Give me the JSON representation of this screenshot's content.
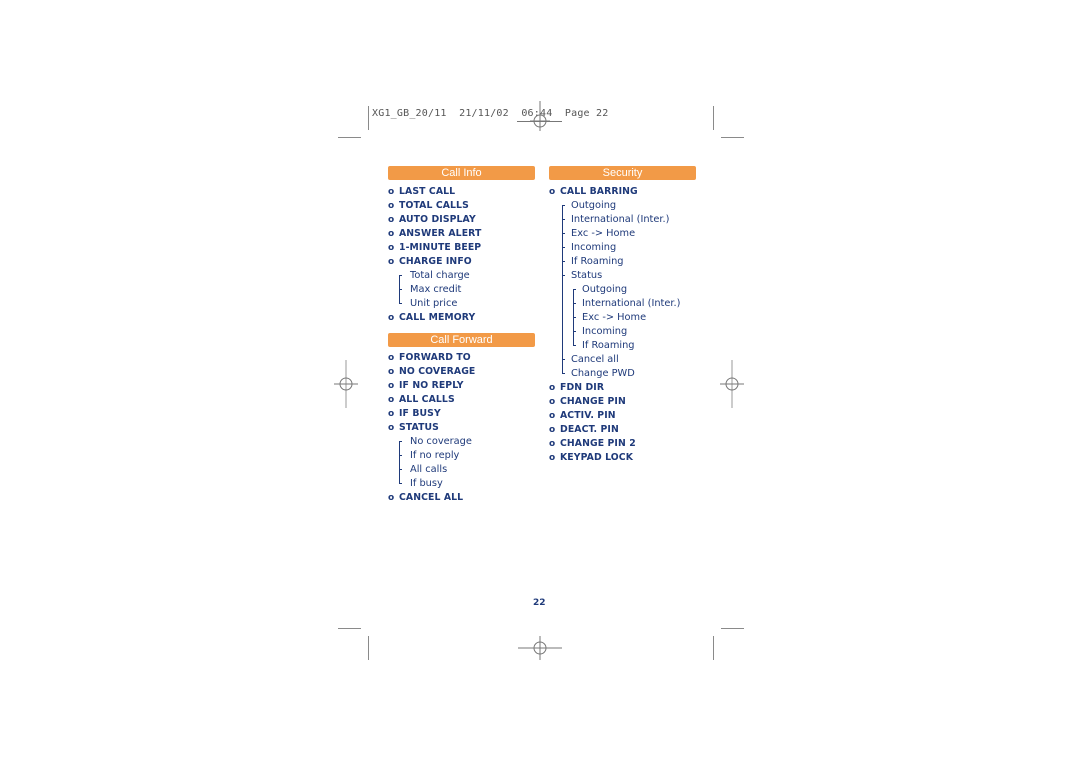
{
  "header": {
    "file": "XG1_GB_20/11",
    "date": "21/11/02",
    "time": "06:44",
    "page_label": "Page",
    "page_number": "22"
  },
  "columns": {
    "left": {
      "sections": [
        {
          "title": "Call Info",
          "items": [
            {
              "label": "LAST CALL"
            },
            {
              "label": "TOTAL CALLS"
            },
            {
              "label": "AUTO DISPLAY"
            },
            {
              "label": "ANSWER ALERT"
            },
            {
              "label": "1-MINUTE BEEP"
            },
            {
              "label": "CHARGE INFO",
              "children": [
                "Total charge",
                "Max credit",
                "Unit price"
              ]
            },
            {
              "label": "CALL MEMORY"
            }
          ]
        },
        {
          "title": "Call Forward",
          "items": [
            {
              "label": "FORWARD TO"
            },
            {
              "label": "NO COVERAGE"
            },
            {
              "label": "IF NO REPLY"
            },
            {
              "label": "ALL CALLS"
            },
            {
              "label": "IF BUSY"
            },
            {
              "label": "STATUS",
              "children": [
                "No coverage",
                "If no reply",
                "All calls",
                "If busy"
              ]
            },
            {
              "label": "CANCEL ALL"
            }
          ]
        }
      ]
    },
    "right": {
      "sections": [
        {
          "title": "Security",
          "items": [
            {
              "label": "CALL BARRING",
              "children": [
                "Outgoing",
                "International (Inter.)",
                "Exc -> Home",
                "Incoming",
                "If Roaming",
                "Status",
                "Outgoing",
                "International (Inter.)",
                "Exc -> Home",
                "Incoming",
                "If Roaming",
                "Cancel all",
                "Change PWD"
              ]
            },
            {
              "label": "FDN DIR"
            },
            {
              "label": "CHANGE PIN"
            },
            {
              "label": "ACTIV. PIN"
            },
            {
              "label": "DEACT. PIN"
            },
            {
              "label": "CHANGE PIN 2"
            },
            {
              "label": "KEYPAD LOCK"
            }
          ]
        }
      ]
    }
  },
  "bullet": "o",
  "footer": {
    "page_number": "22"
  },
  "colors": {
    "section_bar": "#f29a47",
    "text": "#1f3a7a",
    "crop_marks": "#8a8a8a"
  }
}
